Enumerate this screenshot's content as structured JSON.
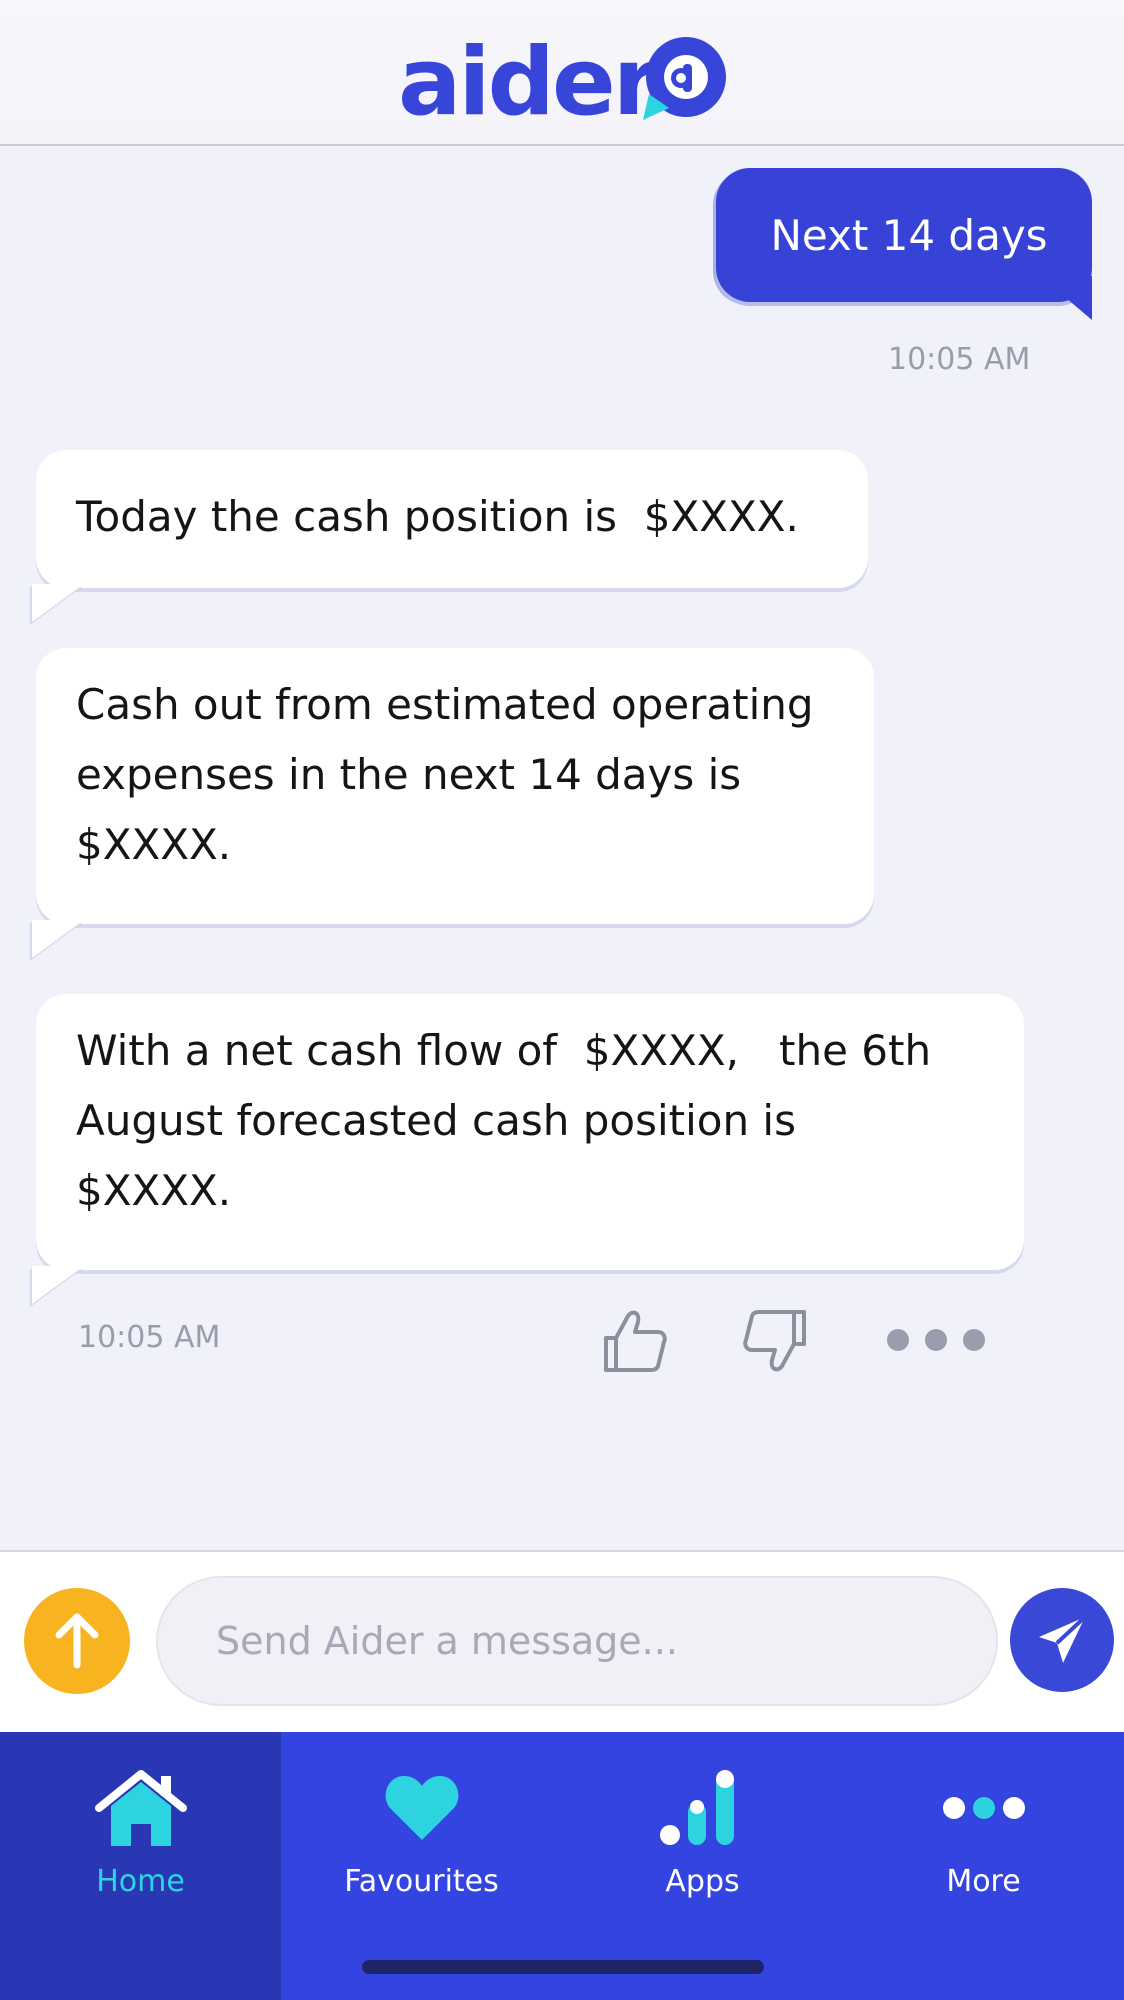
{
  "app": {
    "logo_text": "aider",
    "logo_mark": "a"
  },
  "colors": {
    "brand_blue": "#3643d6",
    "accent_cyan": "#2dd4e0",
    "upload_yellow": "#f7b320"
  },
  "conversation": {
    "user_message": "Next 14 days",
    "user_timestamp": "10:05 AM",
    "bot_messages": [
      {
        "text": "Today the cash position is  $XXXX."
      },
      {
        "line1": "Cash out from estimated operating",
        "line2": "expenses in the next 14 days is",
        "line3": "$XXXX."
      },
      {
        "line1": "With a net cash flow of  $XXXX,   the 6th",
        "line2": "August forecasted cash position is",
        "line3": "$XXXX."
      }
    ],
    "bot_timestamp": "10:05 AM",
    "actions": {
      "like_icon": "thumbs-up-icon",
      "dislike_icon": "thumbs-down-icon",
      "more_icon": "more-dots-icon"
    }
  },
  "composer": {
    "placeholder": "Send Aider a message...",
    "upload_icon": "arrow-up-icon",
    "send_icon": "paper-plane-icon"
  },
  "tabbar": {
    "tabs": [
      {
        "label": "Home",
        "icon": "home-icon",
        "active": true
      },
      {
        "label": "Favourites",
        "icon": "heart-icon",
        "active": false
      },
      {
        "label": "Apps",
        "icon": "apps-bars-icon",
        "active": false
      },
      {
        "label": "More",
        "icon": "more-dots-icon",
        "active": false
      }
    ]
  }
}
